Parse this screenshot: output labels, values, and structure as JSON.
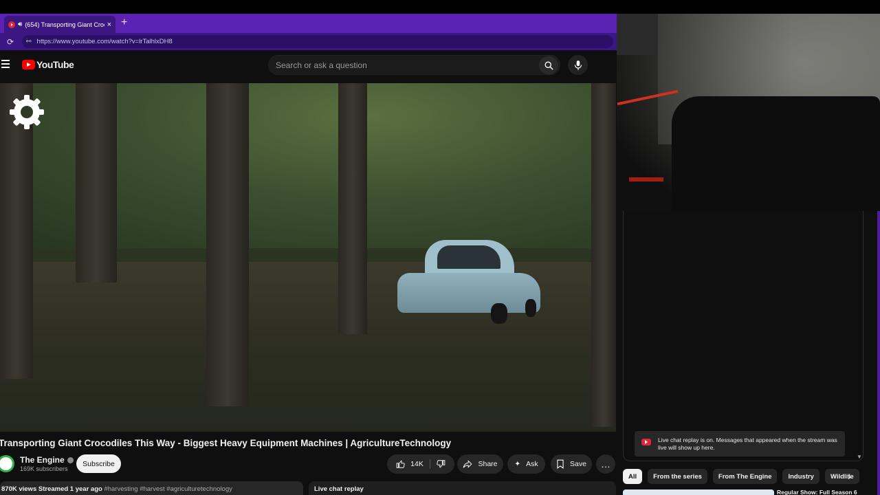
{
  "browser": {
    "tab_title": "(654) Transporting Giant Croc",
    "tab_close": "×",
    "new_tab": "+",
    "url": "https://www.youtube.com/watch?v=lrTalhlxDH8"
  },
  "header": {
    "logo_text": "YouTube",
    "search_placeholder": "Search or ask a question"
  },
  "video": {
    "title": "Transporting Giant Crocodiles This Way - Biggest Heavy Equipment Machines | AgricultureTechnology"
  },
  "channel": {
    "name": "The Engine",
    "subscribers": "169K subscribers",
    "subscribe_label": "Subscribe"
  },
  "actions": {
    "likes": "14K",
    "share": "Share",
    "ask": "Ask",
    "save": "Save",
    "more": "…"
  },
  "description": {
    "views": "870K views",
    "streamed": "Streamed 1 year ago",
    "tags": "#harvesting #harvest #agriculturetechnology"
  },
  "live_chat_replay_label": "Live chat replay",
  "chat": {
    "note": "Live chat replay is on. Messages that appeared when the stream was live will show up here."
  },
  "chips": [
    "All",
    "From the series",
    "From The Engine",
    "Industry",
    "Wildlife"
  ],
  "chips_next": "›",
  "next_video_title": "Regular Show: Full Season 6",
  "colors": {
    "browser_purple": "#4b1d96",
    "youtube_red": "#ff0000",
    "background": "#0f0f0f"
  }
}
